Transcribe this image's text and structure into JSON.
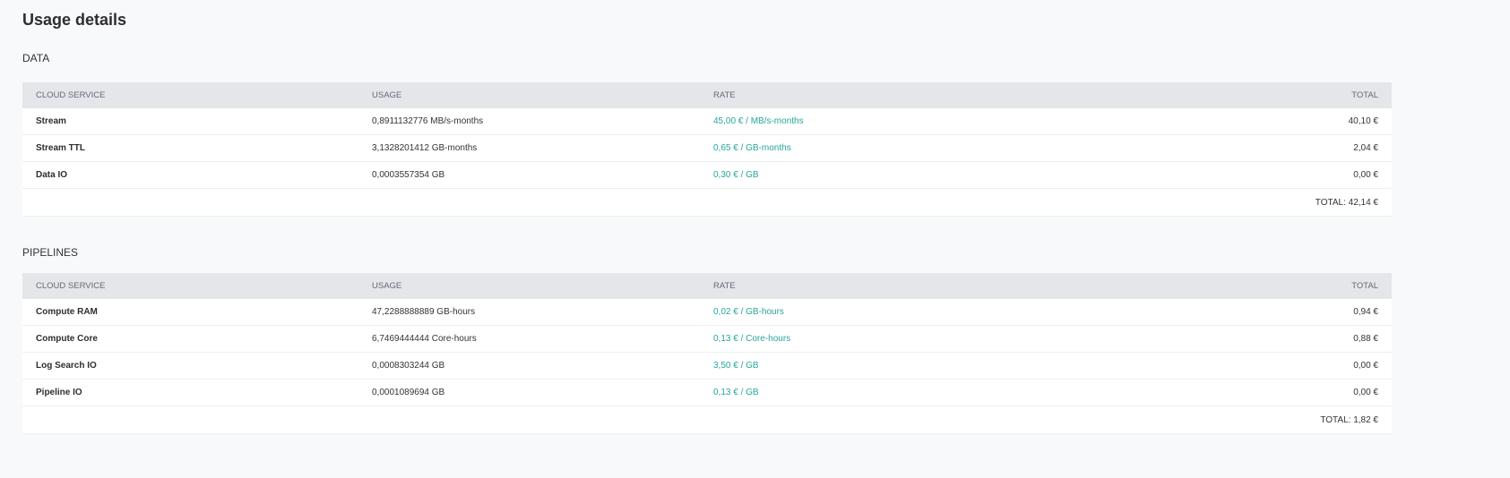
{
  "title": "Usage details",
  "columns": [
    "CLOUD SERVICE",
    "USAGE",
    "RATE",
    "TOTAL"
  ],
  "colors": {
    "accent": "#26a69a",
    "header_bg": "#e5e6ea",
    "page_bg": "#f8f9fb"
  },
  "sections": [
    {
      "label": "DATA",
      "rows": [
        {
          "service": "Stream",
          "usage": "0,8911132776 MB/s-months",
          "rate": "45,00 € / MB/s-months",
          "total": "40,10 €"
        },
        {
          "service": "Stream TTL",
          "usage": "3,1328201412 GB-months",
          "rate": "0,65 € / GB-months",
          "total": "2,04 €"
        },
        {
          "service": "Data IO",
          "usage": "0,0003557354 GB",
          "rate": "0,30 € / GB",
          "total": "0,00 €"
        }
      ],
      "total": "TOTAL: 42,14 €"
    },
    {
      "label": "PIPELINES",
      "rows": [
        {
          "service": "Compute RAM",
          "usage": "47,2288888889 GB-hours",
          "rate": "0,02 € / GB-hours",
          "total": "0,94 €"
        },
        {
          "service": "Compute Core",
          "usage": "6,7469444444 Core-hours",
          "rate": "0,13 € / Core-hours",
          "total": "0,88 €"
        },
        {
          "service": "Log Search IO",
          "usage": "0,0008303244 GB",
          "rate": "3,50 € / GB",
          "total": "0,00 €"
        },
        {
          "service": "Pipeline IO",
          "usage": "0,0001089694 GB",
          "rate": "0,13 € / GB",
          "total": "0,00 €"
        }
      ],
      "total": "TOTAL: 1,82 €"
    }
  ]
}
